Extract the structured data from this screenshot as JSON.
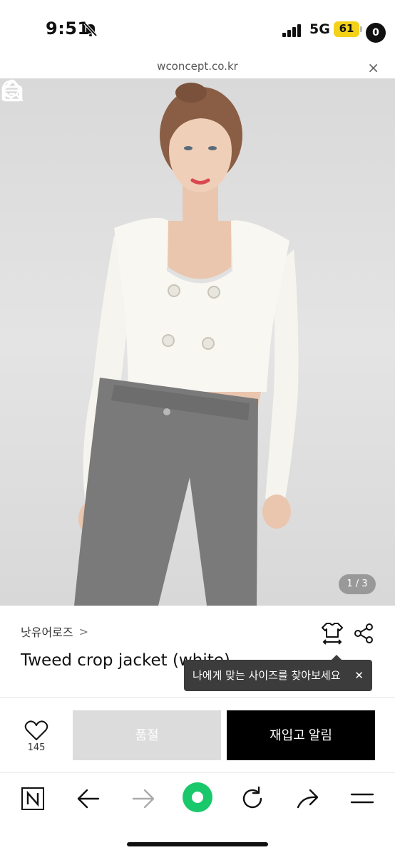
{
  "status": {
    "time": "9:51",
    "network": "5G",
    "battery": "61"
  },
  "browser": {
    "url": "wconcept.co.kr",
    "close": "×"
  },
  "colors": {
    "accent_green": "#19c86a",
    "battery_yellow": "#f4d21a",
    "restock_bg": "#000000",
    "soldout_bg": "#dcdcdc"
  },
  "product": {
    "cart_count": "0",
    "pager": "1 / 3",
    "brand": "낫유어로즈",
    "brand_chevron": ">",
    "title": "Tweed crop jacket (white)",
    "tooltip": "나에게 맞는 사이즈를 찾아보세요",
    "tooltip_close": "✕"
  },
  "actions": {
    "like_count": "145",
    "soldout_label": "품절",
    "restock_label": "재입고 알림"
  },
  "icons": [
    "back-arrow-icon",
    "home-icon",
    "search-icon",
    "cart-icon",
    "size-guide-icon",
    "share-icon",
    "heart-icon",
    "naver-icon",
    "browser-back-icon",
    "browser-forward-icon",
    "green-dot-icon",
    "reload-icon",
    "browser-share-icon",
    "menu-icon"
  ]
}
